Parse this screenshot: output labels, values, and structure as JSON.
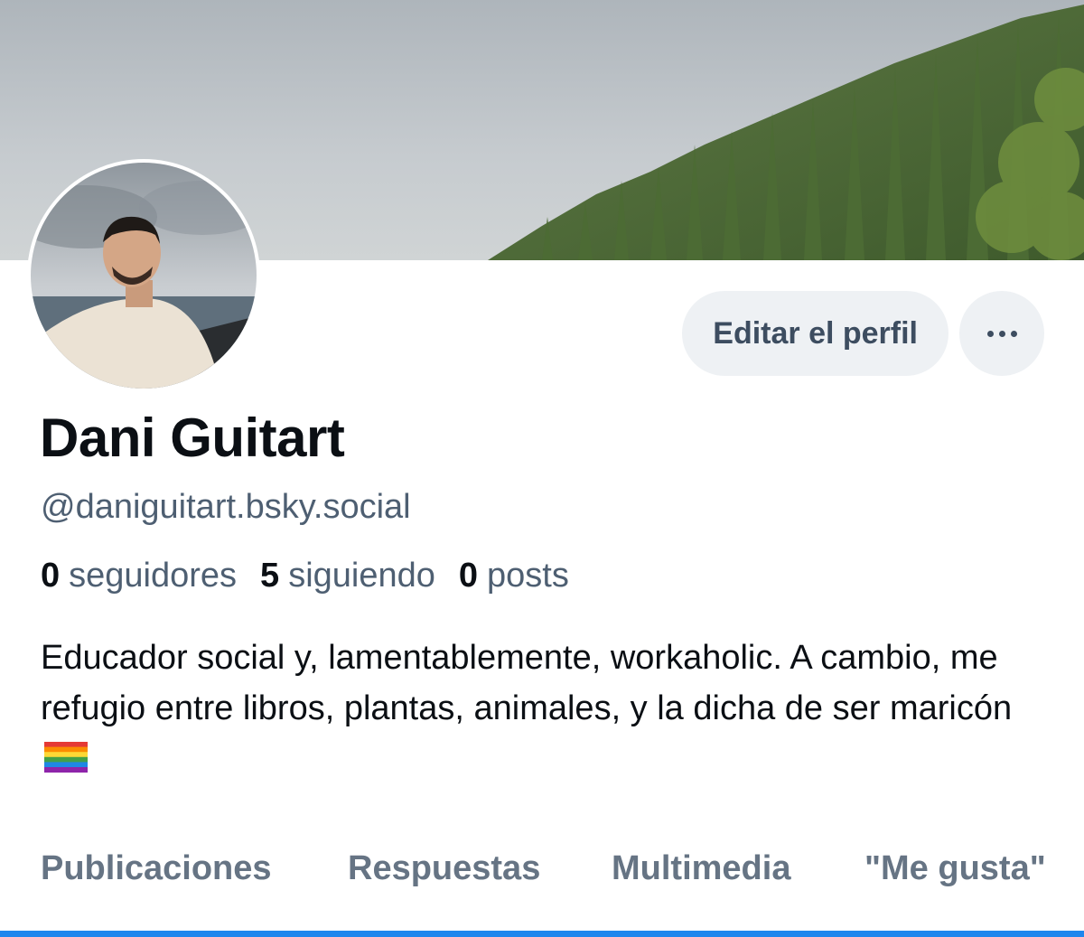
{
  "profile": {
    "display_name": "Dani Guitart",
    "handle": "@daniguitart.bsky.social",
    "stats": {
      "followers_count": "0",
      "followers_label": "seguidores",
      "following_count": "5",
      "following_label": "siguiendo",
      "posts_count": "0",
      "posts_label": "posts"
    },
    "bio": "Educador social y, lamentablemente, workaholic. A cambio, me refugio entre libros, plantas, animales, y la dicha de ser maricón",
    "bio_emoji": "rainbow-flag-icon"
  },
  "actions": {
    "edit_label": "Editar el perfil",
    "more_icon": "more-options-icon"
  },
  "tabs": [
    {
      "label": "Publicaciones"
    },
    {
      "label": "Respuestas"
    },
    {
      "label": "Multimedia"
    },
    {
      "label": "\"Me gusta\""
    }
  ],
  "colors": {
    "accent": "#1d86ee",
    "text_primary": "#0b0f14",
    "text_secondary": "#4e5f72",
    "button_bg": "#eef1f4"
  }
}
